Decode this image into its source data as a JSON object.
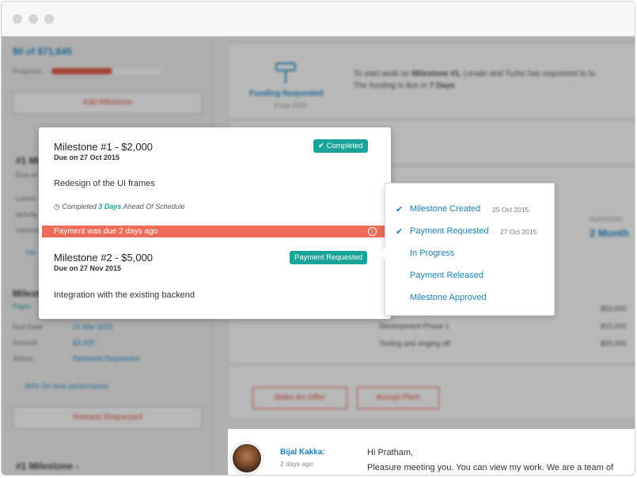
{
  "sidebar": {
    "amount": "$0 of $71,645",
    "progress_label": "Progress",
    "progress_fraction": 0.55,
    "add_milestone": "Add Milestone",
    "milestone_short": "#1 Mi",
    "milestone_due": "Due on",
    "body_lines": [
      "Lorem",
      "activity",
      "commen"
    ],
    "view_link": "Vie",
    "milestone2_heading": "Milesto",
    "milestone2_status": "Paym",
    "details": [
      {
        "label": "Due Date",
        "value": "21 Mar 2015"
      },
      {
        "label": "Amount",
        "value": "$3,000"
      },
      {
        "label": "Status",
        "value": "Released Requested"
      }
    ],
    "ontime": "80% On time performance",
    "release_button": "Release Requested",
    "footer_milestone": "#1 Milestone -"
  },
  "main": {
    "funding_title": "Funding Requested",
    "funding_date": "3 Sep 2015",
    "funding_text1_prefix": "To start work on ",
    "funding_text1_bold": "Milestone #1",
    "funding_text1_suffix": ", Lenain and Turbo has requested to fu",
    "funding_text2_prefix": "The funding is due in ",
    "funding_text2_bold": "7 Days",
    "duration_label": "DURATION",
    "duration_value": "2 Month",
    "rows": [
      {
        "label": "",
        "amount": "$50,000"
      },
      {
        "label": "Development Phase 1",
        "amount": "$10,000"
      },
      {
        "label": "Testing and singing off",
        "amount": "$50,000"
      }
    ],
    "make_offer": "Make An Offer",
    "accept_pitch": "Accept Pitch"
  },
  "popup": {
    "milestone1": {
      "title": "Milestone #1 - $2,000",
      "due": "Due on 27 Oct 2015",
      "badge": "Completed",
      "description": "Redesign of the UI frames",
      "note_prefix": "Completed ",
      "note_days": "3 Days",
      "note_suffix": " Ahead Of Schedule"
    },
    "due_bar": "Payment was due 2 days ago",
    "milestone2": {
      "title": "Milestone #2 - $5,000",
      "due": "Due on 27 Nov 2015",
      "badge": "Payment Requested",
      "description": "Integration with the existing backend"
    }
  },
  "status_menu": [
    {
      "label": "Milestone Created",
      "date": "25 Oct 2015",
      "checked": true
    },
    {
      "label": "Payment Requested",
      "date": "27 Oct 2015",
      "checked": true
    },
    {
      "label": "In Progress",
      "date": "",
      "checked": false
    },
    {
      "label": "Payment Released",
      "date": "",
      "checked": false
    },
    {
      "label": "Milestone Approved",
      "date": "",
      "checked": false
    }
  ],
  "message": {
    "name": "Bijal Kakka:",
    "time": "2 days ago",
    "greeting": "Hi Pratham,",
    "body": "Pleasure meeting you. You can view my work. We are a team of"
  },
  "colors": {
    "accent_blue": "#1a7fb8",
    "teal": "#1aa398",
    "alert": "#ee6b58"
  }
}
